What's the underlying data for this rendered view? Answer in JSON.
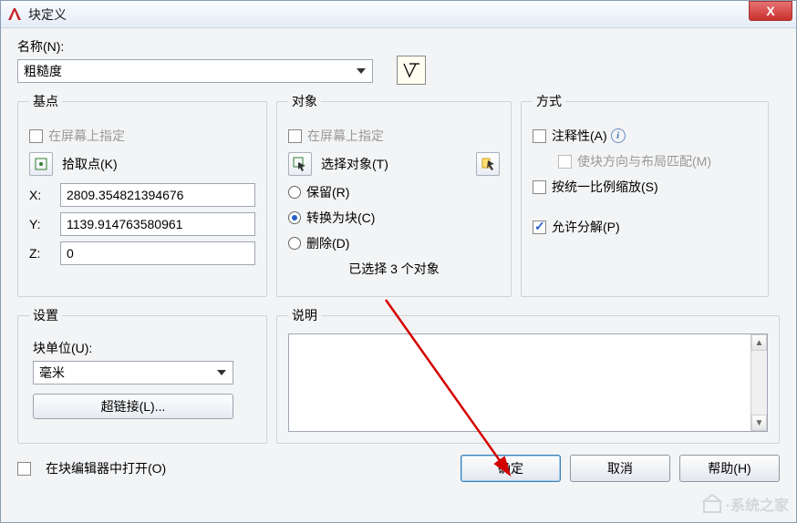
{
  "title": "块定义",
  "close_x": "X",
  "name_section": {
    "label": "名称(N):",
    "value": "粗糙度"
  },
  "base": {
    "legend": "基点",
    "specify_on_screen": "在屏幕上指定",
    "pick_point": "拾取点(K)",
    "x_label": "X:",
    "y_label": "Y:",
    "z_label": "Z:",
    "x_value": "2809.354821394676",
    "y_value": "1139.914763580961",
    "z_value": "0"
  },
  "objects": {
    "legend": "对象",
    "specify_on_screen": "在屏幕上指定",
    "select_objects": "选择对象(T)",
    "retain": "保留(R)",
    "convert": "转换为块(C)",
    "delete": "删除(D)",
    "selected_info": "已选择 3 个对象"
  },
  "behavior": {
    "legend": "方式",
    "annotative": "注释性(A)",
    "match_layout": "使块方向与布局匹配(M)",
    "scale_uniform": "按统一比例缩放(S)",
    "allow_exploding": "允许分解(P)"
  },
  "settings": {
    "legend": "设置",
    "block_unit_label": "块单位(U):",
    "block_unit_value": "毫米",
    "hyperlink": "超链接(L)..."
  },
  "description": {
    "legend": "说明",
    "text": ""
  },
  "footer": {
    "open_in_editor": "在块编辑器中打开(O)",
    "ok": "确定",
    "cancel": "取消",
    "help": "帮助(H)"
  },
  "watermark": "·系统之家"
}
